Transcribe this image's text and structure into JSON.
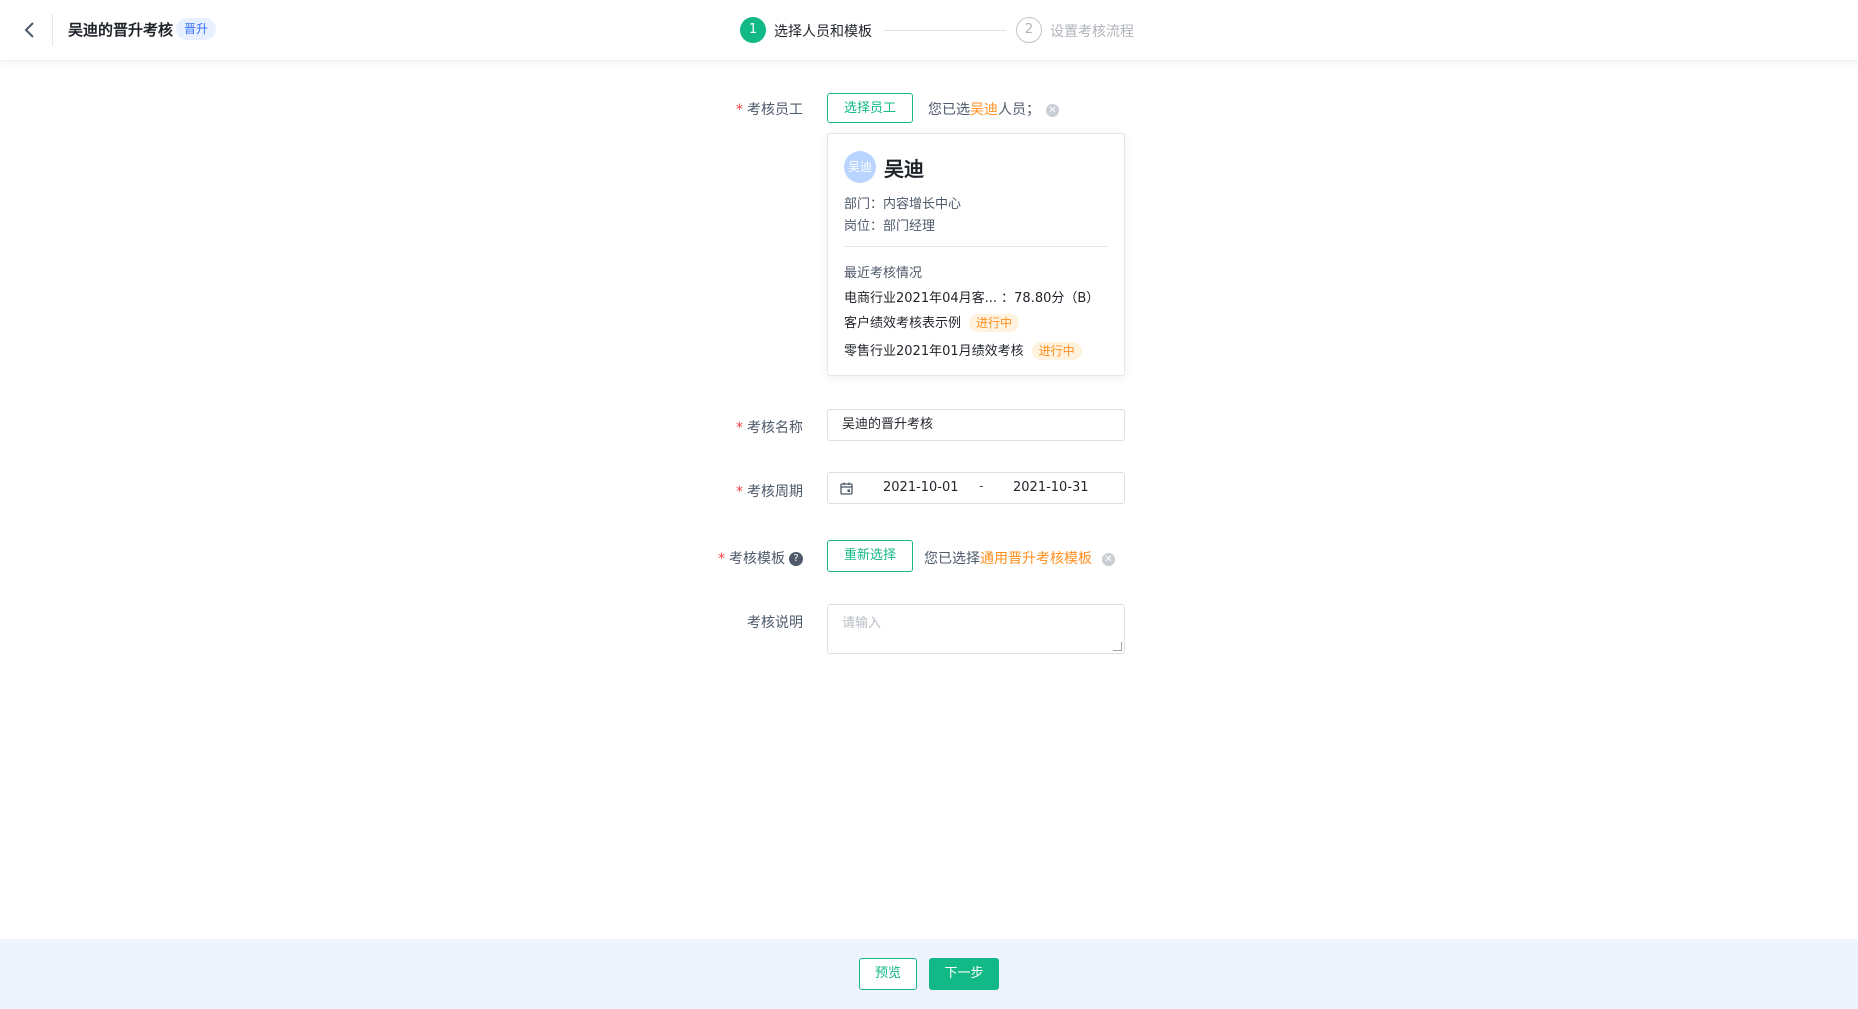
{
  "header": {
    "title": "吴迪的晋升考核",
    "tag": "晋升",
    "steps": [
      {
        "number": "1",
        "label": "选择人员和模板"
      },
      {
        "number": "2",
        "label": "设置考核流程"
      }
    ]
  },
  "form": {
    "employee": {
      "label": "考核员工",
      "button": "选择员工",
      "selected_prefix": "您已选",
      "selected_name": "吴迪",
      "selected_suffix": "人员；",
      "card": {
        "avatar_text": "吴迪",
        "name": "吴迪",
        "department": "部门：内容增长中心",
        "position": "岗位：部门经理",
        "recent_title": "最近考核情况",
        "records": [
          {
            "text": "电商行业2021年04月客...  ：78.80分（B）",
            "status": ""
          },
          {
            "text": "客户绩效考核表示例",
            "status": "进行中"
          },
          {
            "text": "零售行业2021年01月绩效考核",
            "status": "进行中"
          }
        ]
      }
    },
    "name": {
      "label": "考核名称",
      "value": "吴迪的晋升考核"
    },
    "period": {
      "label": "考核周期",
      "start": "2021-10-01",
      "separator": "-",
      "end": "2021-10-31"
    },
    "template": {
      "label": "考核模板",
      "button": "重新选择",
      "selected_prefix": "您已选择",
      "selected_name": "通用晋升考核模板"
    },
    "description": {
      "label": "考核说明",
      "placeholder": "请输入"
    }
  },
  "footer": {
    "preview": "预览",
    "next": "下一步"
  },
  "colors": {
    "primary": "#12b886",
    "highlight": "#ff8f1f",
    "required": "#f53f3f",
    "tag_blue": "#3370ff",
    "footer_bg": "#edf4fd"
  }
}
